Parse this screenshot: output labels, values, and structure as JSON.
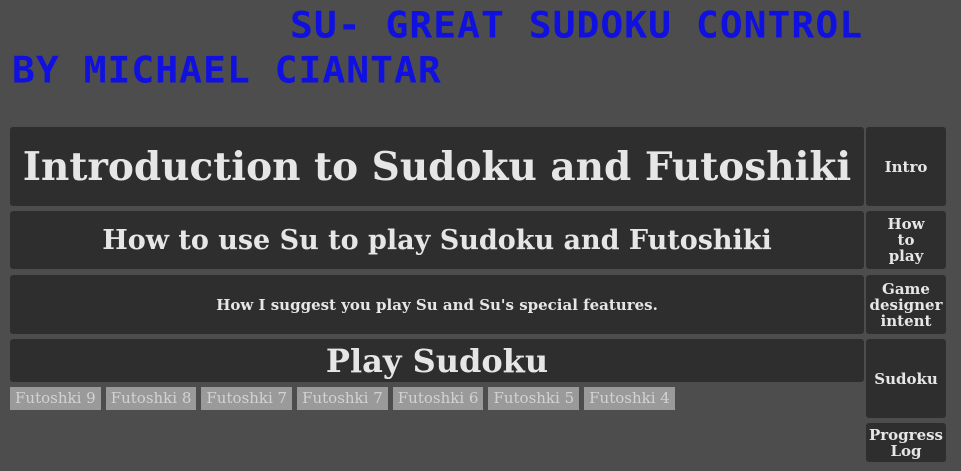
{
  "header": {
    "title": "SU- GREAT SUDOKU CONTROL",
    "author": "BY MICHAEL CIANTAR"
  },
  "main": {
    "intro_title": "Introduction to Sudoku and Futoshiki",
    "howto_title": "How to use Su to play Sudoku and Futoshiki",
    "suggest_title": "How I suggest you play Su and Su's special features.",
    "play_title": "Play Sudoku"
  },
  "futoshiki_buttons": [
    "Futoshki 9",
    "Futoshki 8",
    "Futoshki 7",
    "Futoshki 7",
    "Futoshki 6",
    "Futoshki 5",
    "Futoshki 4"
  ],
  "sidebar": {
    "intro": "Intro",
    "howto": "How to play",
    "designer": "Game designer intent",
    "sudoku": "Sudoku",
    "progress": "Progress Log"
  },
  "colors": {
    "background": "#4d4d4d",
    "panel": "#2e2e2e",
    "title_blue": "#1010e0",
    "futoshiki_button": "#9a9a9a"
  }
}
